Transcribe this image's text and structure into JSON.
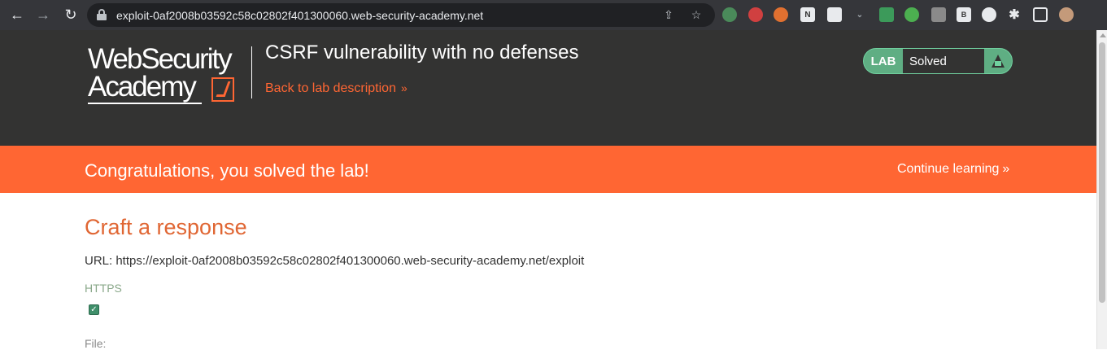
{
  "browser": {
    "url": "exploit-0af2008b03592c58c02802f401300060.web-security-academy.net",
    "back_icon": "←",
    "forward_icon": "→",
    "reload_icon": "↻",
    "share_icon": "⇪",
    "star_icon": "☆",
    "ext_b_label": "B"
  },
  "header": {
    "logo_line1": "WebSecurity",
    "logo_line2": "Academy",
    "lab_title": "CSRF vulnerability with no defenses",
    "back_link": "Back to lab description",
    "back_chevron": "»",
    "status_lab": "LAB",
    "status_text": "Solved"
  },
  "banner": {
    "message": "Congratulations, you solved the lab!",
    "continue_link": "Continue learning",
    "continue_chevron": "»"
  },
  "main": {
    "heading": "Craft a response",
    "url_line": "URL: https://exploit-0af2008b03592c58c02802f401300060.web-security-academy.net/exploit",
    "https_label": "HTTPS",
    "https_checked": "✓",
    "file_label": "File:"
  },
  "colors": {
    "accent": "#ff6633",
    "header_bg": "#333332",
    "solved_green": "#70d19f"
  }
}
